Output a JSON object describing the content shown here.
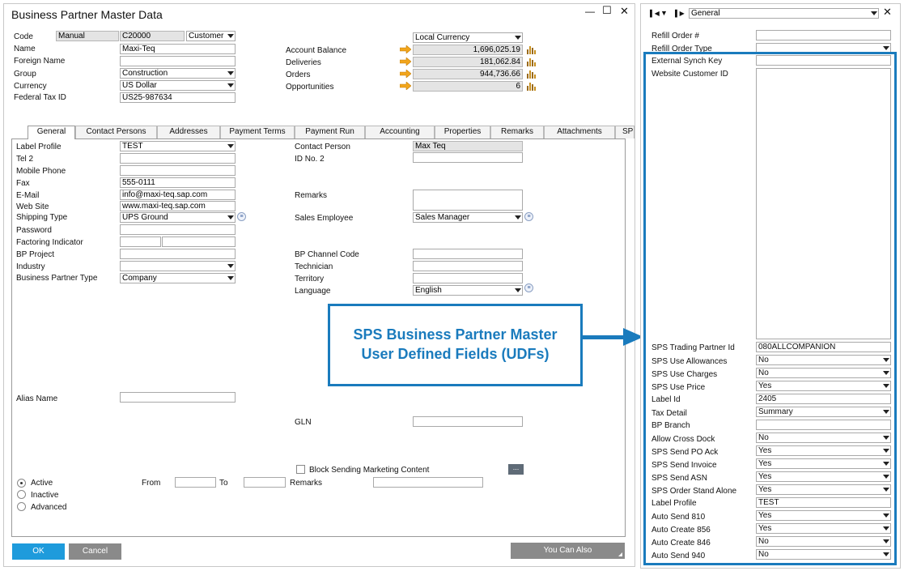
{
  "main_window": {
    "title": "Business Partner Master Data",
    "controls": {
      "minimize": "—",
      "maximize": "☐",
      "close": "✕"
    }
  },
  "header_fields": {
    "code_label": "Code",
    "code_series": "Manual",
    "code_value": "C20000",
    "code_type": "Customer",
    "name_label": "Name",
    "name_value": "Maxi-Teq",
    "foreign_name_label": "Foreign Name",
    "group_label": "Group",
    "group_value": "Construction",
    "currency_label": "Currency",
    "currency_value": "US Dollar",
    "federal_tax_id_label": "Federal Tax ID",
    "federal_tax_id_value": "US25-987634",
    "currency_display": "Local Currency",
    "account_balance_label": "Account Balance",
    "account_balance_value": "1,696,025.19",
    "deliveries_label": "Deliveries",
    "deliveries_value": "181,062.84",
    "orders_label": "Orders",
    "orders_value": "944,736.66",
    "opportunities_label": "Opportunities",
    "opportunities_value": "6"
  },
  "tabs": [
    "General",
    "Contact Persons",
    "Addresses",
    "Payment Terms",
    "Payment Run",
    "Accounting",
    "Properties",
    "Remarks",
    "Attachments",
    "SP"
  ],
  "general": {
    "label_profile_label": "Label Profile",
    "label_profile_value": "TEST",
    "tel2_label": "Tel 2",
    "mobile_phone_label": "Mobile Phone",
    "fax_label": "Fax",
    "fax_value": "555-0111",
    "email_label": "E-Mail",
    "email_value": "info@maxi-teq.sap.com",
    "website_label": "Web Site",
    "website_value": "www.maxi-teq.sap.com",
    "shipping_type_label": "Shipping Type",
    "shipping_type_value": "UPS Ground",
    "password_label": "Password",
    "factoring_indicator_label": "Factoring Indicator",
    "bp_project_label": "BP Project",
    "industry_label": "Industry",
    "bp_type_label": "Business Partner Type",
    "bp_type_value": "Company",
    "contact_person_label": "Contact Person",
    "contact_person_value": "Max Teq",
    "id_no2_label": "ID No. 2",
    "remarks_label": "Remarks",
    "sales_employee_label": "Sales Employee",
    "sales_employee_value": "Sales Manager",
    "bp_channel_code_label": "BP Channel Code",
    "technician_label": "Technician",
    "territory_label": "Territory",
    "language_label": "Language",
    "language_value": "English",
    "alias_name_label": "Alias Name",
    "gln_label": "GLN",
    "block_marketing_label": "Block Sending Marketing Content",
    "ellipsis": "...",
    "active_label": "Active",
    "inactive_label": "Inactive",
    "advanced_label": "Advanced",
    "from_label": "From",
    "to_label": "To",
    "status_remarks_label": "Remarks"
  },
  "buttons": {
    "ok": "OK",
    "cancel": "Cancel",
    "you_can_also": "You Can Also"
  },
  "callout": {
    "line1": "SPS Business Partner Master",
    "line2": "User Defined Fields (UDFs)"
  },
  "udf_panel": {
    "category": "General",
    "fields": [
      {
        "label": "Refill Order #",
        "value": ""
      },
      {
        "label": "Refill Order Type",
        "value": ""
      },
      {
        "label": "External Synch Key",
        "value": ""
      },
      {
        "label": "Website Customer ID",
        "value": ""
      },
      {
        "label": "SPS Trading Partner Id",
        "value": "080ALLCOMPANION"
      },
      {
        "label": "SPS Use Allowances",
        "value": "No"
      },
      {
        "label": "SPS Use Charges",
        "value": "No"
      },
      {
        "label": "SPS Use Price",
        "value": "Yes"
      },
      {
        "label": "Label Id",
        "value": "2405"
      },
      {
        "label": "Tax Detail",
        "value": "Summary"
      },
      {
        "label": "BP Branch",
        "value": ""
      },
      {
        "label": "Allow Cross Dock",
        "value": "No"
      },
      {
        "label": "SPS Send PO Ack",
        "value": "Yes"
      },
      {
        "label": "SPS Send Invoice",
        "value": "Yes"
      },
      {
        "label": "SPS Send ASN",
        "value": "Yes"
      },
      {
        "label": "SPS Order Stand Alone",
        "value": "Yes"
      },
      {
        "label": "Label Profile",
        "value": "TEST"
      },
      {
        "label": "Auto Send 810",
        "value": "Yes"
      },
      {
        "label": "Auto Create 856",
        "value": "Yes"
      },
      {
        "label": "Auto Create 846",
        "value": "No"
      },
      {
        "label": "Auto Send 940",
        "value": "No"
      }
    ]
  },
  "colors": {
    "accent_blue": "#1a7bbd",
    "ok_button": "#1e9bdc",
    "gray_button": "#8a8a8a",
    "arrow_orange": "#f2a51b"
  }
}
